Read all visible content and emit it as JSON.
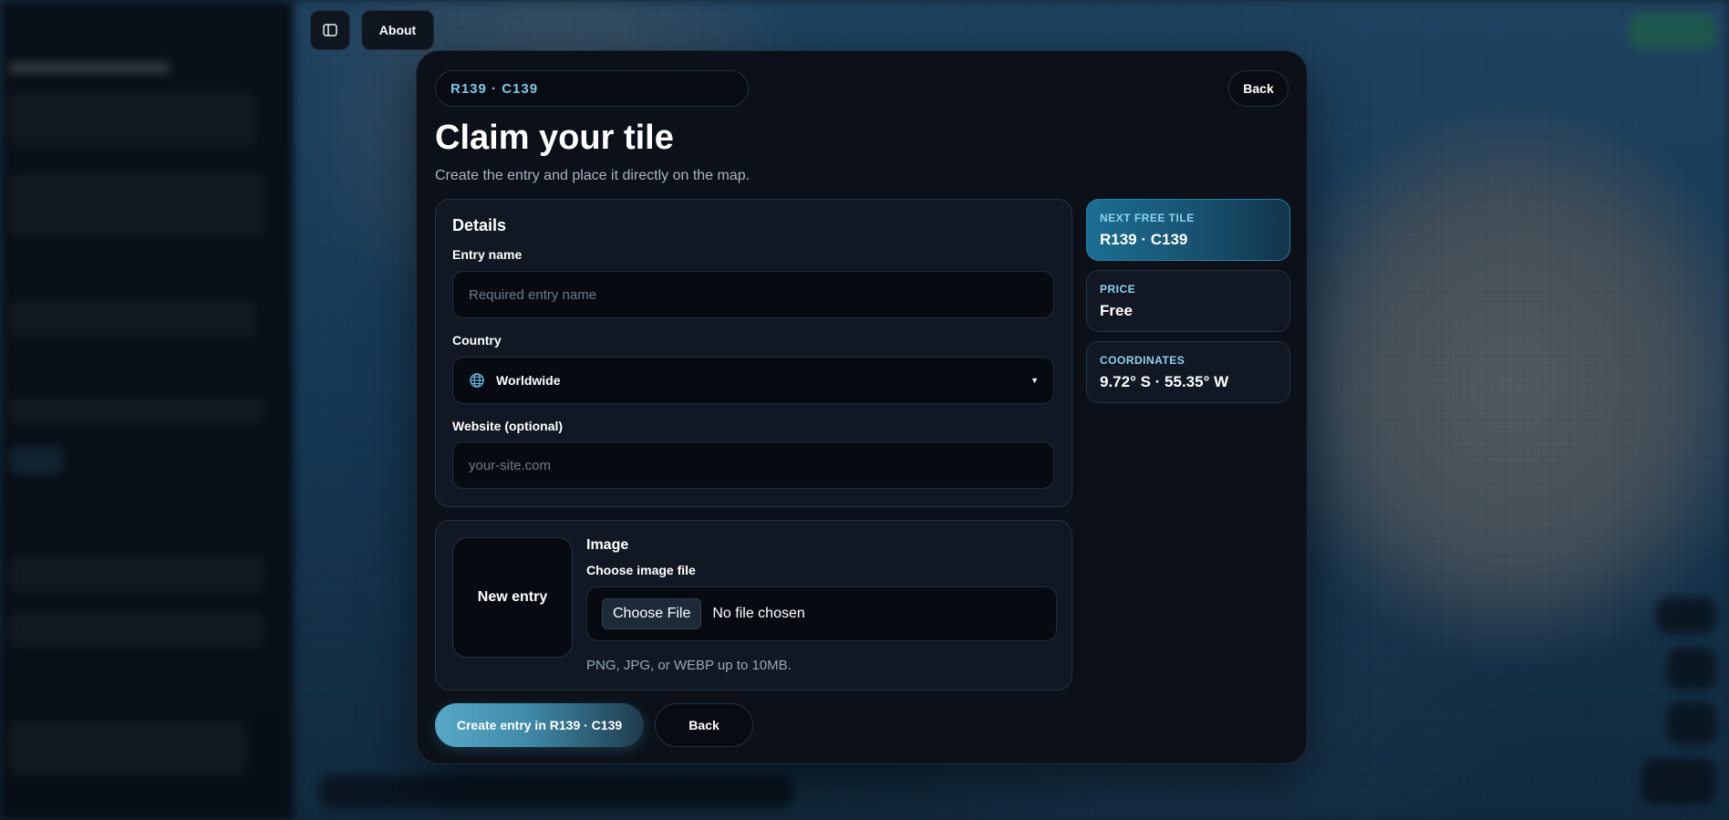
{
  "topbar": {
    "about_label": "About"
  },
  "modal": {
    "tile_id": "R139 · C139",
    "back_label": "Back",
    "title": "Claim your tile",
    "subtitle": "Create the entry and place it directly on the map.",
    "details": {
      "title": "Details",
      "entry_name": {
        "label": "Entry name",
        "value": "",
        "placeholder": "Required entry name"
      },
      "country": {
        "label": "Country",
        "selected": "Worldwide"
      },
      "website": {
        "label": "Website (optional)",
        "value": "",
        "placeholder": "your-site.com"
      }
    },
    "image": {
      "preview_label": "New entry",
      "title": "Image",
      "file_label": "Choose image file",
      "choose_button": "Choose File",
      "file_status": "No file chosen",
      "hint": "PNG, JPG, or WEBP up to 10MB."
    },
    "actions": {
      "create_label": "Create entry in R139 · C139",
      "back_label": "Back"
    },
    "info": [
      {
        "label": "NEXT FREE TILE",
        "value": "R139 · C139"
      },
      {
        "label": "PRICE",
        "value": "Free"
      },
      {
        "label": "COORDINATES",
        "value": "9.72° S · 55.35° W"
      }
    ]
  },
  "colors": {
    "accent": "#57a9c8",
    "modal_bg": "#0c1119",
    "card_bg": "#111823",
    "label_accent": "#8fd2ef"
  },
  "icons": {
    "panel_toggle": "sidebar-panel-icon",
    "country": "globe-icon",
    "select_caret": "caret-down-icon"
  }
}
